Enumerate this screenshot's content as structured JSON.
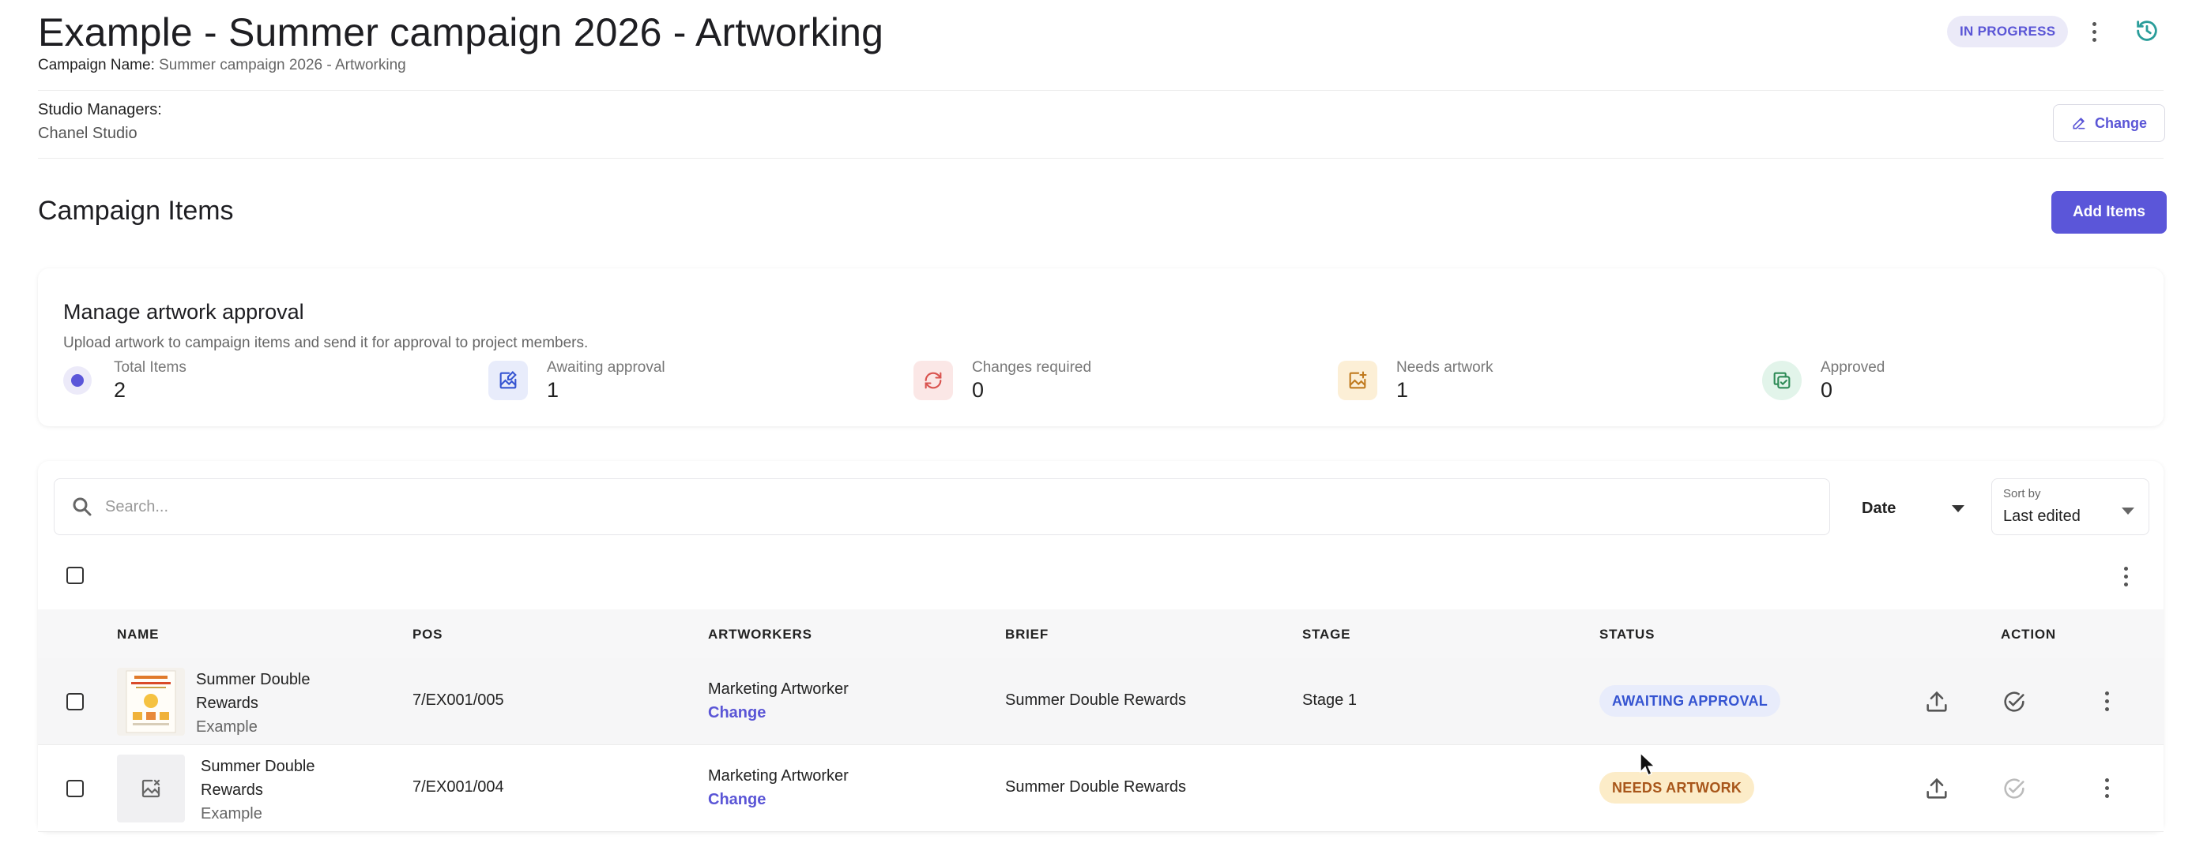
{
  "header": {
    "title": "Example - Summer campaign 2026 - Artworking",
    "campaign_name_label": "Campaign Name:",
    "campaign_name_value": "Summer campaign 2026 - Artworking",
    "status": "IN PROGRESS"
  },
  "studio": {
    "label": "Studio Managers:",
    "value": "Chanel Studio",
    "change_label": "Change"
  },
  "items_section": {
    "title": "Campaign Items",
    "add_label": "Add Items"
  },
  "approval": {
    "title": "Manage artwork approval",
    "subtitle": "Upload artwork to campaign items and send it for approval to project members.",
    "stats": [
      {
        "label": "Total Items",
        "value": "2",
        "icon": "radio-dot-icon",
        "color": "#5b56d9"
      },
      {
        "label": "Awaiting approval",
        "value": "1",
        "icon": "image-edit-icon",
        "color": "#3554d1"
      },
      {
        "label": "Changes required",
        "value": "0",
        "icon": "refresh-icon",
        "color": "#d9534f"
      },
      {
        "label": "Needs artwork",
        "value": "1",
        "icon": "image-add-icon",
        "color": "#c07a1e"
      },
      {
        "label": "Approved",
        "value": "0",
        "icon": "copy-check-icon",
        "color": "#2e8b57"
      }
    ]
  },
  "toolbar": {
    "search_placeholder": "Search...",
    "date_label": "Date",
    "sort_caption": "Sort by",
    "sort_value": "Last edited"
  },
  "table": {
    "columns": [
      "NAME",
      "POS",
      "ARTWORKERS",
      "BRIEF",
      "STAGE",
      "STATUS",
      "ACTION"
    ],
    "rows": [
      {
        "name": "Summer Double Rewards",
        "sub": "Example",
        "pos": "7/EX001/005",
        "artworker": "Marketing Artworker",
        "artworker_action": "Change",
        "brief": "Summer Double Rewards",
        "stage": "Stage 1",
        "status": "AWAITING APPROVAL"
      },
      {
        "name": "Summer Double Rewards",
        "sub": "Example",
        "pos": "7/EX001/004",
        "artworker": "Marketing Artworker",
        "artworker_action": "Change",
        "brief": "Summer Double Rewards",
        "stage": "",
        "status": "NEEDS ARTWORK"
      }
    ]
  },
  "colors": {
    "accent": "#5b56d9",
    "teal": "#2a9d9a"
  }
}
